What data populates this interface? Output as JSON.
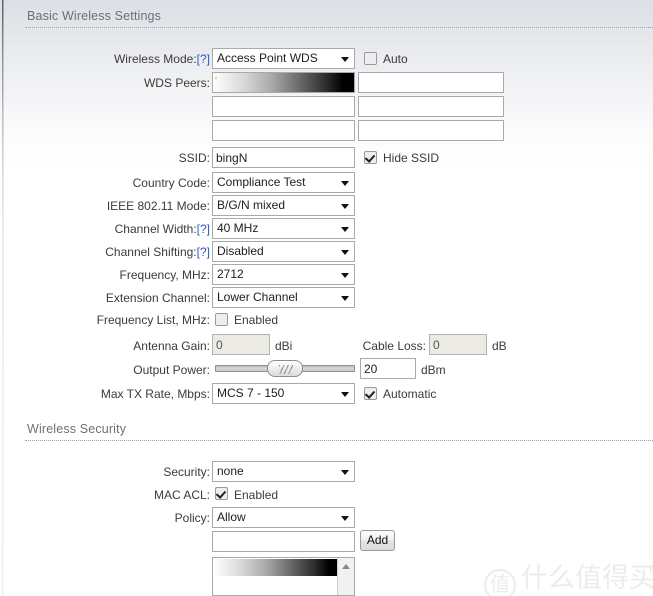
{
  "sections": {
    "basic": {
      "title": "Basic Wireless Settings"
    },
    "security": {
      "title": "Wireless Security"
    }
  },
  "basic": {
    "wireless_mode": {
      "label": "Wireless Mode:",
      "help": "[?]",
      "value": "Access Point WDS",
      "auto_label": "Auto",
      "auto_checked": false
    },
    "wds_peers": {
      "label": "WDS Peers:",
      "row1_left_value": "",
      "row1_right_value": "",
      "row2_left_value": "",
      "row2_right_value": "",
      "row3_left_value": "",
      "row3_right_value": ""
    },
    "ssid": {
      "label": "SSID:",
      "value": "bingN",
      "hide_label": "Hide SSID",
      "hide_checked": true
    },
    "country_code": {
      "label": "Country Code:",
      "value": "Compliance Test"
    },
    "ieee_mode": {
      "label": "IEEE 802.11 Mode:",
      "value": "B/G/N mixed"
    },
    "channel_width": {
      "label": "Channel Width:",
      "help": "[?]",
      "value": "40 MHz"
    },
    "channel_shifting": {
      "label": "Channel Shifting:",
      "help": "[?]",
      "value": "Disabled"
    },
    "frequency": {
      "label": "Frequency, MHz:",
      "value": "2712"
    },
    "extension_channel": {
      "label": "Extension Channel:",
      "value": "Lower Channel"
    },
    "frequency_list": {
      "label": "Frequency List, MHz:",
      "enabled_label": "Enabled",
      "enabled_checked": false
    },
    "antenna_gain": {
      "label": "Antenna Gain:",
      "value": "0",
      "unit": "dBi"
    },
    "cable_loss": {
      "label": "Cable Loss:",
      "value": "0",
      "unit": "dB"
    },
    "output_power": {
      "label": "Output Power:",
      "value": "20",
      "unit": "dBm",
      "slider_percent": 50
    },
    "max_tx_rate": {
      "label": "Max TX Rate, Mbps:",
      "value": "MCS 7 - 150",
      "automatic_label": "Automatic",
      "automatic_checked": true
    }
  },
  "security": {
    "security": {
      "label": "Security:",
      "value": "none"
    },
    "mac_acl": {
      "label": "MAC ACL:",
      "enabled_label": "Enabled",
      "enabled_checked": true
    },
    "policy": {
      "label": "Policy:",
      "value": "Allow"
    },
    "mac_entry": {
      "value": "",
      "add_label": "Add"
    },
    "mac_list": {
      "first_item": ""
    }
  },
  "watermark": {
    "mark": "值",
    "text": "什么值得买"
  }
}
